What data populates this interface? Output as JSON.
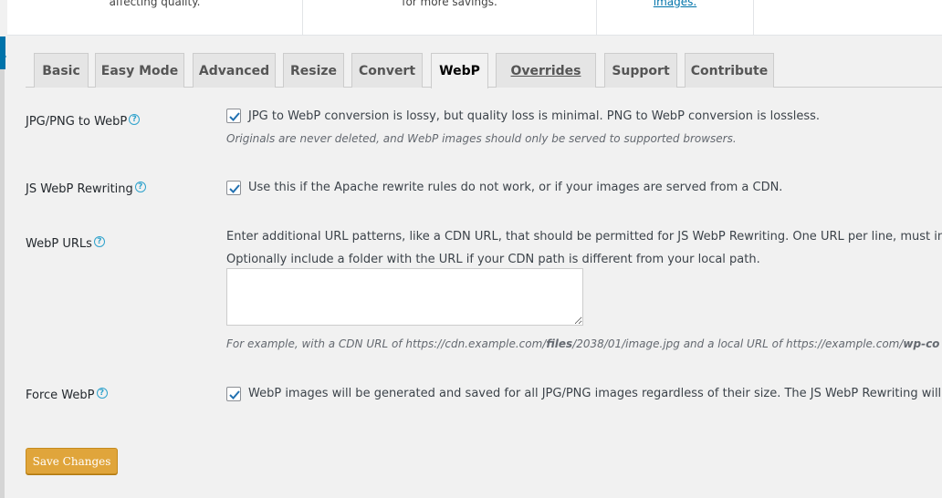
{
  "top_panel": {
    "cells": [
      {
        "text": "affecting quality."
      },
      {
        "text": "for more savings."
      },
      {
        "text": "images."
      }
    ]
  },
  "tabs": [
    {
      "label": "Basic"
    },
    {
      "label": "Easy Mode"
    },
    {
      "label": "Advanced"
    },
    {
      "label": "Resize"
    },
    {
      "label": "Convert"
    },
    {
      "label": "WebP"
    },
    {
      "label": "Overrides"
    },
    {
      "label": "Support"
    },
    {
      "label": "Contribute"
    }
  ],
  "active_tab": "WebP",
  "settings": {
    "jpg_png_to_webp": {
      "label": "JPG/PNG to WebP",
      "checkbox_text": "JPG to WebP conversion is lossy, but quality loss is minimal. PNG to WebP conversion is lossless.",
      "description": "Originals are never deleted, and WebP images should only be served to supported browsers.",
      "checked": true
    },
    "js_webp_rewriting": {
      "label": "JS WebP Rewriting",
      "checkbox_text": "Use this if the Apache rewrite rules do not work, or if your images are served from a CDN.",
      "checked": true
    },
    "webp_urls": {
      "label": "WebP URLs",
      "line1": "Enter additional URL patterns, like a CDN URL, that should be permitted for JS WebP Rewriting. One URL per line, must include t",
      "line2": "Optionally include a folder with the URL if your CDN path is different from your local path.",
      "textarea_value": "",
      "example_prefix": "For example, with a CDN URL of https://cdn.example.com/",
      "example_bold1": "files",
      "example_mid": "/2038/01/image.jpg and a local URL of https://example.com/",
      "example_bold2": "wp-co"
    },
    "force_webp": {
      "label": "Force WebP",
      "checkbox_text": "WebP images will be generated and saved for all JPG/PNG images regardless of their size. The JS WebP Rewriting will not ch",
      "checked": true
    }
  },
  "help_icon_glyph": "?",
  "save_button_label": "Save Changes",
  "colors": {
    "accent": "#0073aa",
    "help": "#2ea2cc",
    "save_button": "#e0a53b"
  }
}
